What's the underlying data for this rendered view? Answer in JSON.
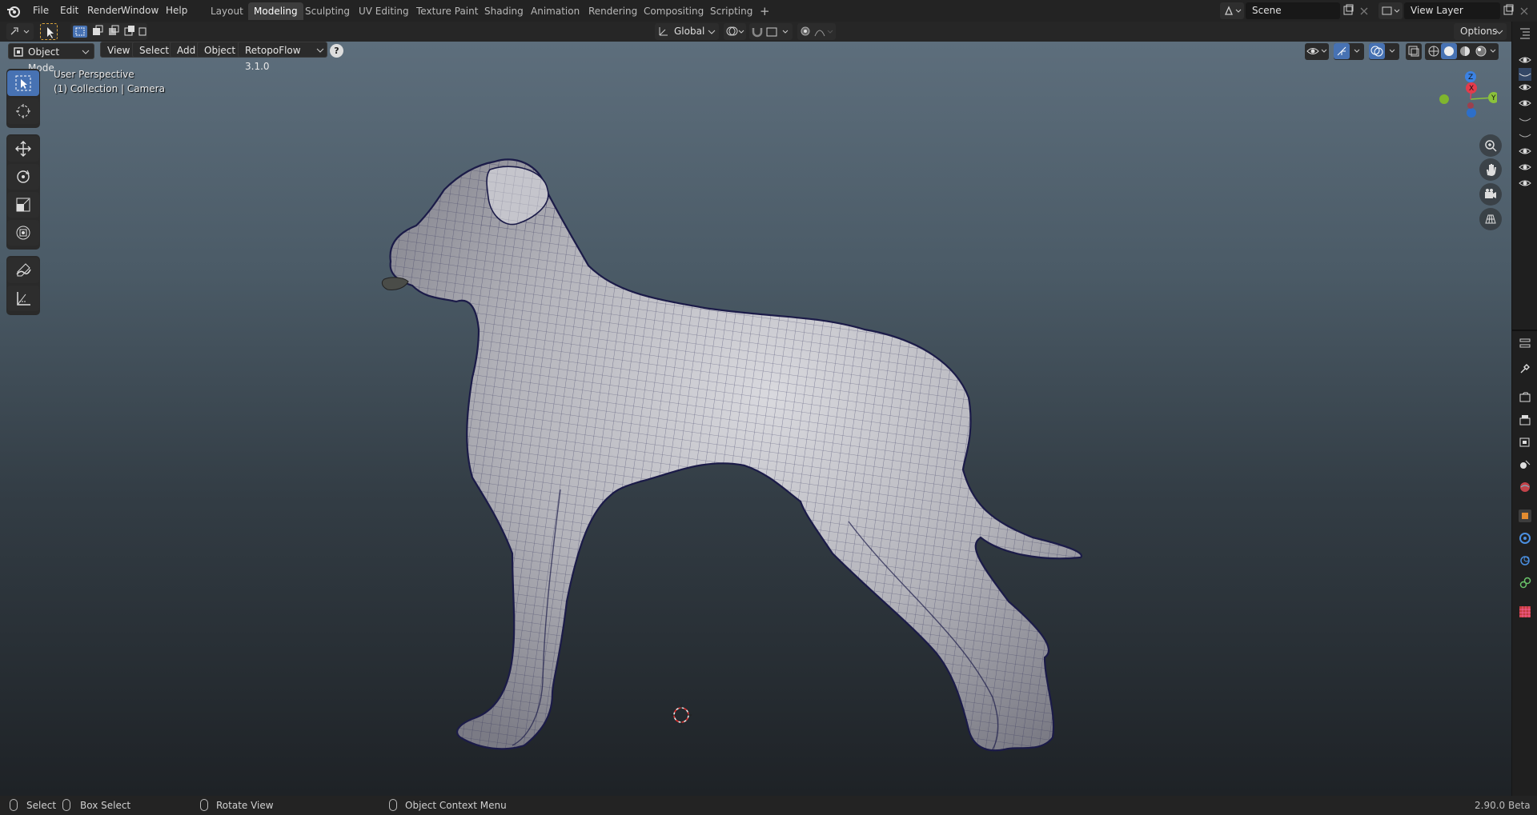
{
  "menus": [
    "File",
    "Edit",
    "Render",
    "Window",
    "Help"
  ],
  "workspace_tabs": [
    "Layout",
    "Modeling",
    "Sculpting",
    "UV Editing",
    "Texture Paint",
    "Shading",
    "Animation",
    "Rendering",
    "Compositing",
    "Scripting"
  ],
  "active_tab": "Modeling",
  "scene": {
    "value": "Scene"
  },
  "view_layer": {
    "value": "View Layer"
  },
  "tool_settings": {
    "orientation": "Global",
    "options": "Options"
  },
  "viewport_header": {
    "mode": "Object Mode",
    "view": "View",
    "select": "Select",
    "add": "Add",
    "object": "Object",
    "addon": "RetopoFlow 3.1.0",
    "help_glyph": "?"
  },
  "viewport_overlay": {
    "perspective": "User Perspective",
    "collection": "(1) Collection | Camera"
  },
  "gizmo": {
    "z": "Z",
    "x": "X",
    "y": "Y"
  },
  "status_bar": {
    "select": "Select",
    "box_select": "Box Select",
    "rotate_view": "Rotate View",
    "context_menu": "Object Context Menu",
    "version": "2.90.0 Beta"
  },
  "colors": {
    "accent": "#4772b3",
    "x_axis": "#e33b4b",
    "y_axis": "#8bc23b",
    "z_axis": "#3b82e3",
    "mesh_wire": "#1a1a4a"
  }
}
